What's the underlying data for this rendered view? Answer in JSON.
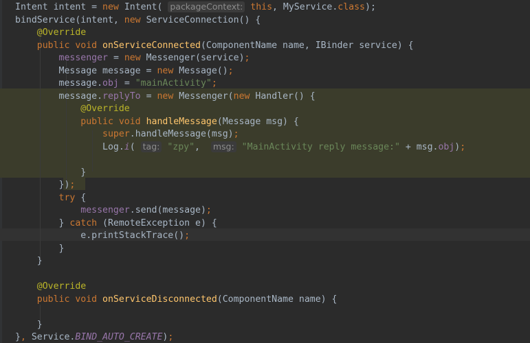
{
  "editor": {
    "colors": {
      "background": "#2b2b2b",
      "keyword": "#cc7832",
      "method": "#ffc66d",
      "annotation": "#bbb529",
      "field": "#9876aa",
      "string": "#6a8759",
      "text": "#a9b7c6",
      "highlight": "#3b3c2b"
    },
    "lines": [
      {
        "tokens": [
          {
            "t": "Intent intent = "
          },
          {
            "t": "new ",
            "c": "kw"
          },
          {
            "t": "Intent( "
          },
          {
            "t": "packageContext:",
            "c": "hint"
          },
          {
            "t": " "
          },
          {
            "t": "this",
            "c": "kw"
          },
          {
            "t": ", MyService."
          },
          {
            "t": "class",
            "c": "kw"
          },
          {
            "t": ");"
          }
        ]
      },
      {
        "tokens": [
          {
            "t": "bindService(intent, "
          },
          {
            "t": "new ",
            "c": "kw"
          },
          {
            "t": "ServiceConnection() {"
          }
        ]
      },
      {
        "tokens": [
          {
            "t": "    "
          },
          {
            "t": "@Override",
            "c": "an"
          }
        ]
      },
      {
        "tokens": [
          {
            "t": "    "
          },
          {
            "t": "public void ",
            "c": "kw"
          },
          {
            "t": "onServiceConnected",
            "c": "fn"
          },
          {
            "t": "(ComponentName name, IBinder service) {"
          }
        ]
      },
      {
        "tokens": [
          {
            "t": "        "
          },
          {
            "t": "messenger",
            "c": "fd"
          },
          {
            "t": " = "
          },
          {
            "t": "new ",
            "c": "kw"
          },
          {
            "t": "Messenger(service)"
          },
          {
            "t": ";",
            "c": "kw"
          }
        ]
      },
      {
        "tokens": [
          {
            "t": "        Message message = "
          },
          {
            "t": "new ",
            "c": "kw"
          },
          {
            "t": "Message()"
          },
          {
            "t": ";",
            "c": "kw"
          }
        ]
      },
      {
        "tokens": [
          {
            "t": "        message."
          },
          {
            "t": "obj",
            "c": "fd"
          },
          {
            "t": " = "
          },
          {
            "t": "\"mainActivity\"",
            "c": "st"
          },
          {
            "t": ";",
            "c": "kw"
          }
        ]
      },
      {
        "tokens": [
          {
            "t": "        message."
          },
          {
            "t": "replyTo",
            "c": "fd"
          },
          {
            "t": " = "
          },
          {
            "t": "new ",
            "c": "kw"
          },
          {
            "t": "Messenger("
          },
          {
            "t": "new ",
            "c": "kw"
          },
          {
            "t": "Handler() {"
          }
        ]
      },
      {
        "tokens": [
          {
            "t": "            "
          },
          {
            "t": "@Override",
            "c": "an"
          }
        ]
      },
      {
        "tokens": [
          {
            "t": "            "
          },
          {
            "t": "public void ",
            "c": "kw"
          },
          {
            "t": "handleMessage",
            "c": "fn"
          },
          {
            "t": "(Message msg) {"
          }
        ]
      },
      {
        "tokens": [
          {
            "t": "                "
          },
          {
            "t": "super",
            "c": "kw"
          },
          {
            "t": ".handleMessage(msg)"
          },
          {
            "t": ";",
            "c": "kw"
          }
        ]
      },
      {
        "tokens": [
          {
            "t": "                Log."
          },
          {
            "t": "i",
            "c": "cs"
          },
          {
            "t": "( "
          },
          {
            "t": "tag:",
            "c": "hint"
          },
          {
            "t": " "
          },
          {
            "t": "\"zpy\"",
            "c": "st"
          },
          {
            "t": ",  "
          },
          {
            "t": "msg:",
            "c": "hint"
          },
          {
            "t": " "
          },
          {
            "t": "\"MainActivity reply message:\"",
            "c": "st"
          },
          {
            "t": " + msg."
          },
          {
            "t": "obj",
            "c": "fd"
          },
          {
            "t": ")"
          },
          {
            "t": ";",
            "c": "kw"
          }
        ]
      },
      {
        "tokens": []
      },
      {
        "tokens": [
          {
            "t": "            }"
          }
        ]
      },
      {
        "tokens": [
          {
            "t": "        })"
          },
          {
            "t": ";",
            "c": "kw"
          }
        ]
      },
      {
        "tokens": [
          {
            "t": "        "
          },
          {
            "t": "try ",
            "c": "kw"
          },
          {
            "t": "{"
          }
        ]
      },
      {
        "tokens": [
          {
            "t": "            "
          },
          {
            "t": "messenger",
            "c": "fd"
          },
          {
            "t": ".send(message)"
          },
          {
            "t": ";",
            "c": "kw"
          }
        ]
      },
      {
        "tokens": [
          {
            "t": "        } "
          },
          {
            "t": "catch ",
            "c": "kw"
          },
          {
            "t": "(RemoteException e) {"
          }
        ]
      },
      {
        "tokens": [
          {
            "t": "            e.printStackTrace()"
          },
          {
            "t": ";",
            "c": "kw"
          }
        ]
      },
      {
        "tokens": [
          {
            "t": "        }"
          }
        ]
      },
      {
        "tokens": [
          {
            "t": "    }"
          }
        ]
      },
      {
        "tokens": []
      },
      {
        "tokens": [
          {
            "t": "    "
          },
          {
            "t": "@Override",
            "c": "an"
          }
        ]
      },
      {
        "tokens": [
          {
            "t": "    "
          },
          {
            "t": "public void ",
            "c": "kw"
          },
          {
            "t": "onServiceDisconnected",
            "c": "fn"
          },
          {
            "t": "(ComponentName name) {"
          }
        ]
      },
      {
        "tokens": []
      },
      {
        "tokens": [
          {
            "t": "    }"
          }
        ]
      },
      {
        "tokens": [
          {
            "t": "}"
          },
          {
            "t": ", ",
            "c": "kw"
          },
          {
            "t": "Service."
          },
          {
            "t": "BIND_AUTO_CREATE",
            "c": "cs"
          },
          {
            "t": ")"
          },
          {
            "t": ";",
            "c": "kw"
          }
        ]
      }
    ]
  }
}
